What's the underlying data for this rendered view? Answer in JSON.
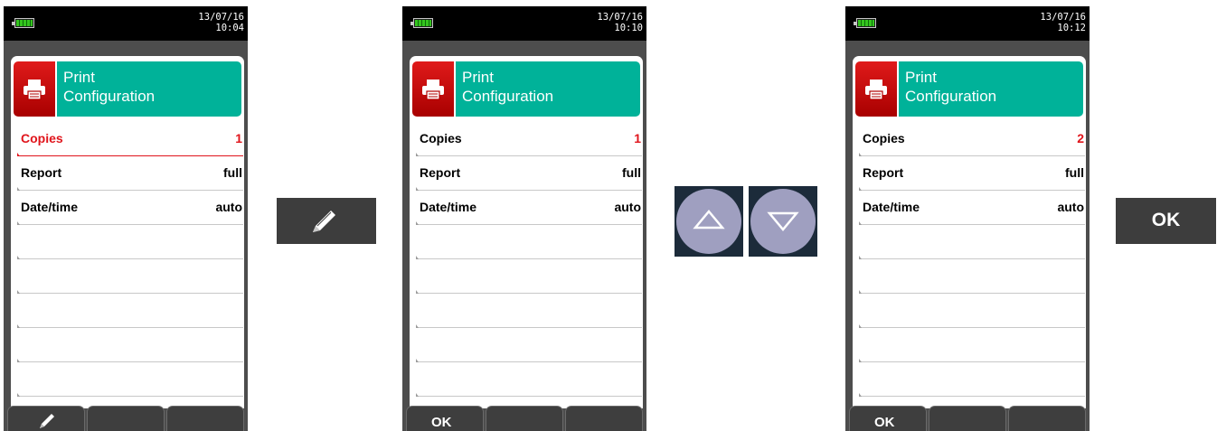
{
  "screens": [
    {
      "status": {
        "date": "13/07/16",
        "time": "10:04"
      },
      "header": {
        "line1": "Print",
        "line2": "Configuration",
        "icon": "printer-icon"
      },
      "rows": [
        {
          "label": "Copies",
          "value": "1",
          "value_color": "red",
          "selected": true
        },
        {
          "label": "Report",
          "value": "full"
        },
        {
          "label": "Date/time",
          "value": "auto"
        }
      ],
      "softkeys": {
        "left_icon": "pencil-icon",
        "left_label": "",
        "middle_label": "",
        "right_label": ""
      }
    },
    {
      "status": {
        "date": "13/07/16",
        "time": "10:10"
      },
      "header": {
        "line1": "Print",
        "line2": "Configuration",
        "icon": "printer-icon"
      },
      "rows": [
        {
          "label": "Copies",
          "value": "1",
          "value_color": "red",
          "selected": false
        },
        {
          "label": "Report",
          "value": "full"
        },
        {
          "label": "Date/time",
          "value": "auto"
        }
      ],
      "softkeys": {
        "left_label": "OK",
        "middle_label": "",
        "right_label": ""
      }
    },
    {
      "status": {
        "date": "13/07/16",
        "time": "10:12"
      },
      "header": {
        "line1": "Print",
        "line2": "Configuration",
        "icon": "printer-icon"
      },
      "rows": [
        {
          "label": "Copies",
          "value": "2",
          "value_color": "red",
          "selected": false
        },
        {
          "label": "Report",
          "value": "full"
        },
        {
          "label": "Date/time",
          "value": "auto"
        }
      ],
      "softkeys": {
        "left_label": "OK",
        "middle_label": "",
        "right_label": ""
      }
    }
  ],
  "actions": {
    "edit_icon": "pencil-icon",
    "up_icon": "triangle-up-icon",
    "down_icon": "triangle-down-icon",
    "ok_label": "OK"
  },
  "colors": {
    "accent_teal": "#00b299",
    "accent_red": "#e0141b",
    "device_gray": "#4d4d4d"
  }
}
